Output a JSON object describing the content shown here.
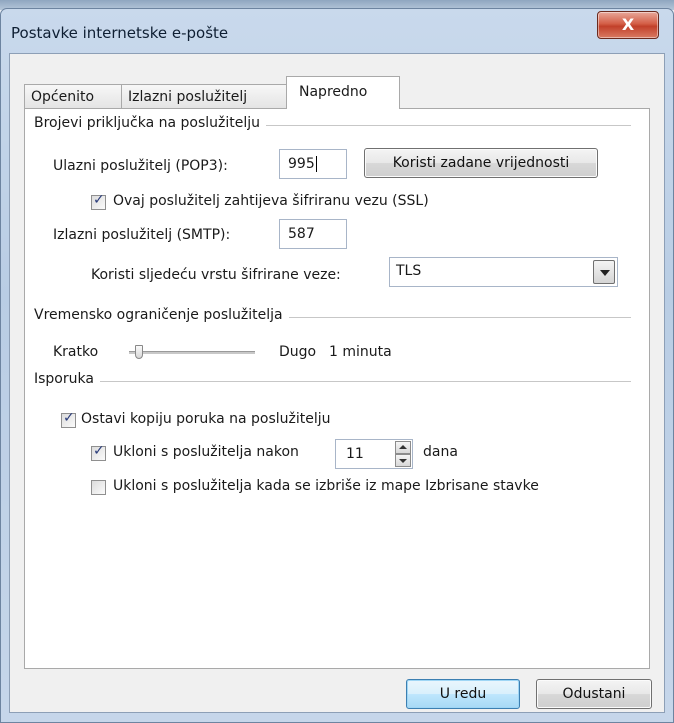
{
  "window": {
    "title": "Postavke internetske e-pošte",
    "close_label": "X"
  },
  "tabs": [
    {
      "label": "Općenito"
    },
    {
      "label": "Izlazni poslužitelj"
    },
    {
      "label": "Napredno",
      "active": true
    }
  ],
  "ports": {
    "group_title": "Brojevi priključka na poslužitelju",
    "incoming_label": "Ulazni poslužitelj (POP3):",
    "incoming_value": "995",
    "defaults_button": "Koristi zadane vrijednosti",
    "ssl_label": "Ovaj poslužitelj zahtijeva šifriranu vezu (SSL)",
    "ssl_checked": true,
    "outgoing_label": "Izlazni poslužitelj (SMTP):",
    "outgoing_value": "587",
    "encryption_label": "Koristi sljedeću vrstu šifrirane veze:",
    "encryption_value": "TLS"
  },
  "timeout": {
    "group_title": "Vremensko ograničenje poslužitelja",
    "short_label": "Kratko",
    "long_label": "Dugo",
    "value_label": "1 minuta",
    "level": 0.05
  },
  "delivery": {
    "group_title": "Isporuka",
    "leave_copy_label": "Ostavi kopiju poruka na poslužitelju",
    "leave_copy_checked": true,
    "remove_after_label": "Ukloni s poslužitelja nakon",
    "remove_after_checked": true,
    "remove_after_days": "11",
    "days_label": "dana",
    "remove_deleted_label": "Ukloni s poslužitelja kada se izbriše iz mape Izbrisane stavke",
    "remove_deleted_checked": false
  },
  "buttons": {
    "ok": "U redu",
    "cancel": "Odustani"
  },
  "glyphs": {
    "check": "✓"
  }
}
